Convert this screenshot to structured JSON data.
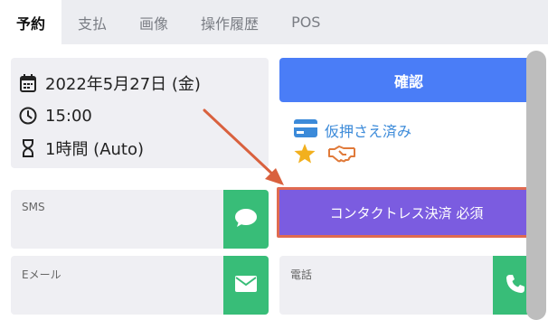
{
  "tabs": [
    {
      "label": "予約",
      "active": true
    },
    {
      "label": "支払",
      "active": false
    },
    {
      "label": "画像",
      "active": false
    },
    {
      "label": "操作履歴",
      "active": false
    },
    {
      "label": "POS",
      "active": false
    }
  ],
  "appointment": {
    "date": "2022年5月27日 (金)",
    "time": "15:00",
    "duration": "1時間 (Auto)"
  },
  "confirm_button": "確認",
  "status": {
    "payment_text": "仮押さえ済み"
  },
  "contactless_button": "コンタクトレス決済 必須",
  "fields": {
    "sms_label": "SMS",
    "email_label": "Eメール",
    "phone_label": "電話"
  },
  "colors": {
    "primary": "#4a7df7",
    "contactless": "#7b5ce0",
    "highlight": "#e06a50",
    "green": "#38bd78",
    "link": "#3b8ad9",
    "star": "#f2b01e",
    "handshake": "#e07a3a"
  },
  "icons": {
    "date": "calendar-icon",
    "time": "clock-icon",
    "duration": "hourglass-icon",
    "payment": "credit-card-icon",
    "star": "star-icon",
    "handshake": "handshake-icon",
    "sms": "chat-bubble-icon",
    "email": "envelope-icon",
    "phone": "phone-icon"
  }
}
